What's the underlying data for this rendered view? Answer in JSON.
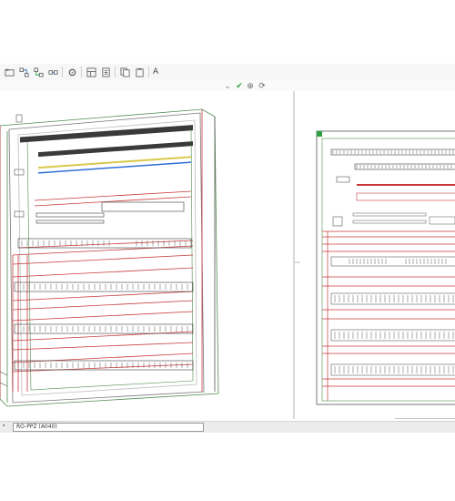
{
  "toolbar": {
    "icons": [
      "open-project-icon",
      "wire-route-icon",
      "wire-route-alt-icon",
      "connect-icon",
      "settings-icon",
      "layout-icon",
      "panel-icon",
      "copy-icon",
      "paste-icon"
    ],
    "text_tool_label": "A"
  },
  "subbar": {
    "check_glyph": "✔",
    "add_glyph": "⊕",
    "refresh_glyph": "⟳"
  },
  "status": {
    "field_value": "RO-PPZ (A040)"
  },
  "colors": {
    "rail": "#3a3a3a",
    "duct": "#c73a3a",
    "frame": "#4f8c4f",
    "accent_green": "#2ea043",
    "accent_blue": "#2f6fd6",
    "yellow_line": "#d9c84a"
  }
}
